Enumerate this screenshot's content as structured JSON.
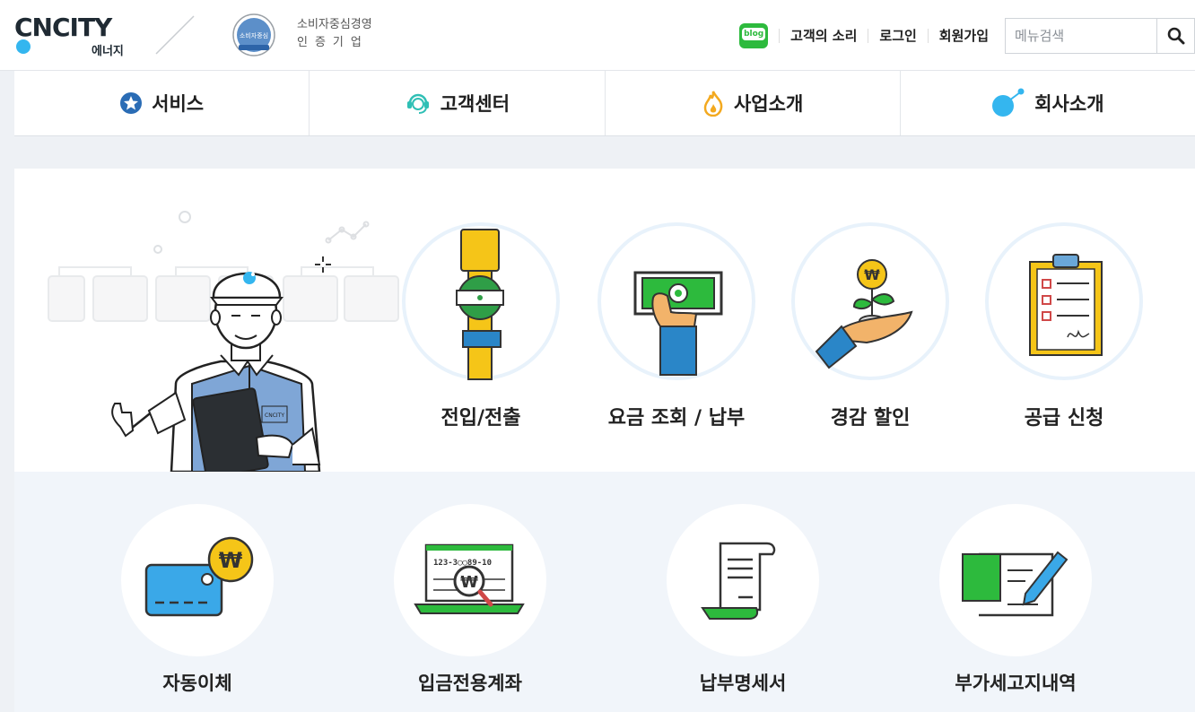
{
  "header": {
    "logo_text": "CNCITY",
    "logo_sub": "에너지",
    "cert_line1": "소비자중심경영",
    "cert_line2": "인증기업",
    "cert_badge_text": "소비자중심",
    "blog_label": "blog",
    "links": [
      "고객의 소리",
      "로그인",
      "회원가입"
    ],
    "search_placeholder": "메뉴검색"
  },
  "nav": {
    "items": [
      {
        "label": "서비스",
        "icon": "star-badge-icon"
      },
      {
        "label": "고객센터",
        "icon": "headset-icon"
      },
      {
        "label": "사업소개",
        "icon": "flame-icon"
      },
      {
        "label": "회사소개",
        "icon": "dot-link-icon"
      }
    ]
  },
  "services": [
    {
      "label": "전입/전출",
      "icon": "gas-pipe-icon"
    },
    {
      "label": "요금 조회 / 납부",
      "icon": "money-hand-icon"
    },
    {
      "label": "경감 할인",
      "icon": "coin-plant-icon"
    },
    {
      "label": "공급 신청",
      "icon": "clipboard-icon"
    }
  ],
  "sub_services": [
    {
      "label": "자동이체",
      "icon": "card-won-icon"
    },
    {
      "label": "입금전용계좌",
      "icon": "laptop-search-icon",
      "account_text": "123-3◯◯89-10"
    },
    {
      "label": "납부명세서",
      "icon": "receipt-scroll-icon"
    },
    {
      "label": "부가세고지내역",
      "icon": "pen-document-icon"
    }
  ],
  "colors": {
    "accent_blue": "#34b6ef",
    "green": "#2dba3d",
    "yellow": "#f5c518"
  }
}
